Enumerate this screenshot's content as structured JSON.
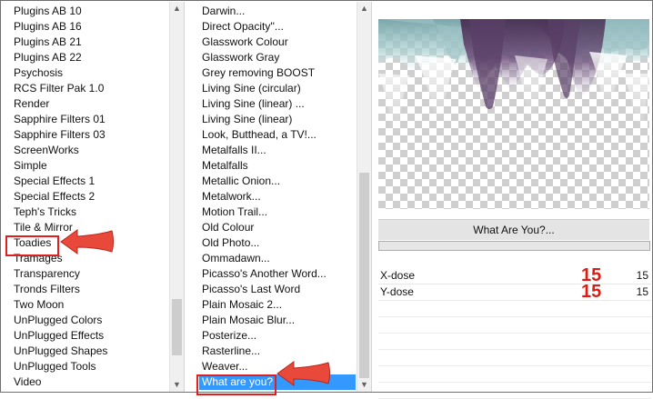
{
  "categories": {
    "items": [
      "Plugins AB 10",
      "Plugins AB 16",
      "Plugins AB 21",
      "Plugins AB 22",
      "Psychosis",
      "RCS Filter Pak 1.0",
      "Render",
      "Sapphire Filters 01",
      "Sapphire Filters 03",
      "ScreenWorks",
      "Simple",
      "Special Effects 1",
      "Special Effects 2",
      "Teph's Tricks",
      "Tile & Mirror",
      "Toadies",
      "Tramages",
      "Transparency",
      "Tronds Filters",
      "Two Moon",
      "UnPlugged Colors",
      "UnPlugged Effects",
      "UnPlugged Shapes",
      "UnPlugged Tools",
      "Video"
    ],
    "highlighted": "Toadies"
  },
  "filters": {
    "items": [
      "Darwin...",
      "Direct Opacity''...",
      "Glasswork Colour",
      "Glasswork Gray",
      "Grey removing BOOST",
      "Living Sine (circular)",
      "Living Sine (linear) ...",
      "Living Sine (linear)",
      "Look, Butthead, a TV!...",
      "Metalfalls II...",
      "Metalfalls",
      "Metallic Onion...",
      "Metalwork...",
      "Motion Trail...",
      "Old Colour",
      "Old Photo...",
      "Ommadawn...",
      "Picasso's Another Word...",
      "Picasso's Last Word",
      "Plain Mosaic 2...",
      "Plain Mosaic Blur...",
      "Posterize...",
      "Rasterline...",
      "Weaver...",
      "What are you?"
    ],
    "selected": "What are you?"
  },
  "effect": {
    "title": "What Are You?...",
    "params": [
      {
        "label": "X-dose",
        "value": "15",
        "annotation": "15"
      },
      {
        "label": "Y-dose",
        "value": "15",
        "annotation": "15"
      }
    ]
  },
  "icons": {
    "scroll_up": "chevron-up-icon",
    "scroll_down": "chevron-down-icon",
    "callout": "red-arrow-icon"
  },
  "colors": {
    "selection": "#3399ff",
    "annotation": "#e02020"
  }
}
